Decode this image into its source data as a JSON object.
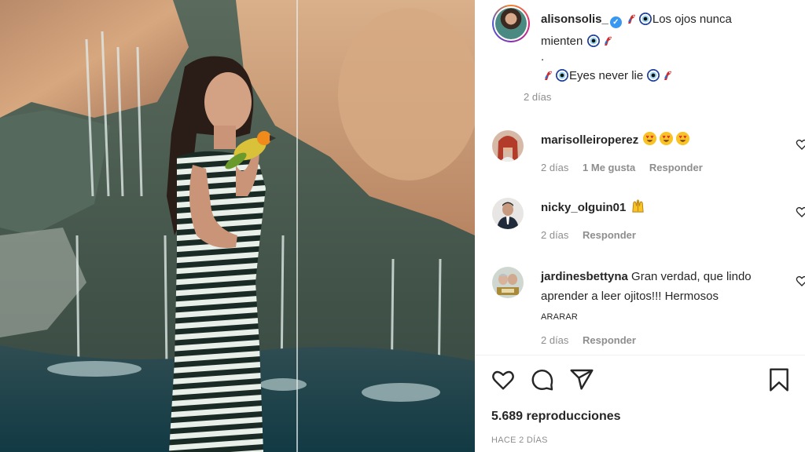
{
  "post": {
    "username": "alisonsolis_",
    "caption_es": "Los ojos nunca mienten",
    "caption_dot": ".",
    "caption_en": "Eyes never lie",
    "time": "2 días"
  },
  "comments": [
    {
      "username": "marisolleiroperez",
      "text": "",
      "time": "2 días",
      "likes": "1 Me gusta",
      "reply": "Responder",
      "emoji": [
        "heart-eyes",
        "heart-eyes",
        "heart-eyes"
      ]
    },
    {
      "username": "nicky_olguin01",
      "text": "",
      "time": "2 días",
      "reply": "Responder",
      "emoji": [
        "raised-hands"
      ]
    },
    {
      "username": "jardinesbettyna",
      "text": "Gran verdad, que lindo aprender a leer ojitos!!! Hermosos",
      "suffix": "ARARAR",
      "time": "2 días",
      "reply": "Responder"
    }
  ],
  "actions": {
    "icons": [
      "heart-icon",
      "comment-icon",
      "share-icon",
      "bookmark-icon"
    ]
  },
  "stats": {
    "views": "5.689 reproducciones",
    "posted": "HACE 2 DÍAS"
  },
  "colors": {
    "verified": "#3897f0",
    "secondary_text": "#8e8e8e",
    "primary_text": "#262626"
  }
}
